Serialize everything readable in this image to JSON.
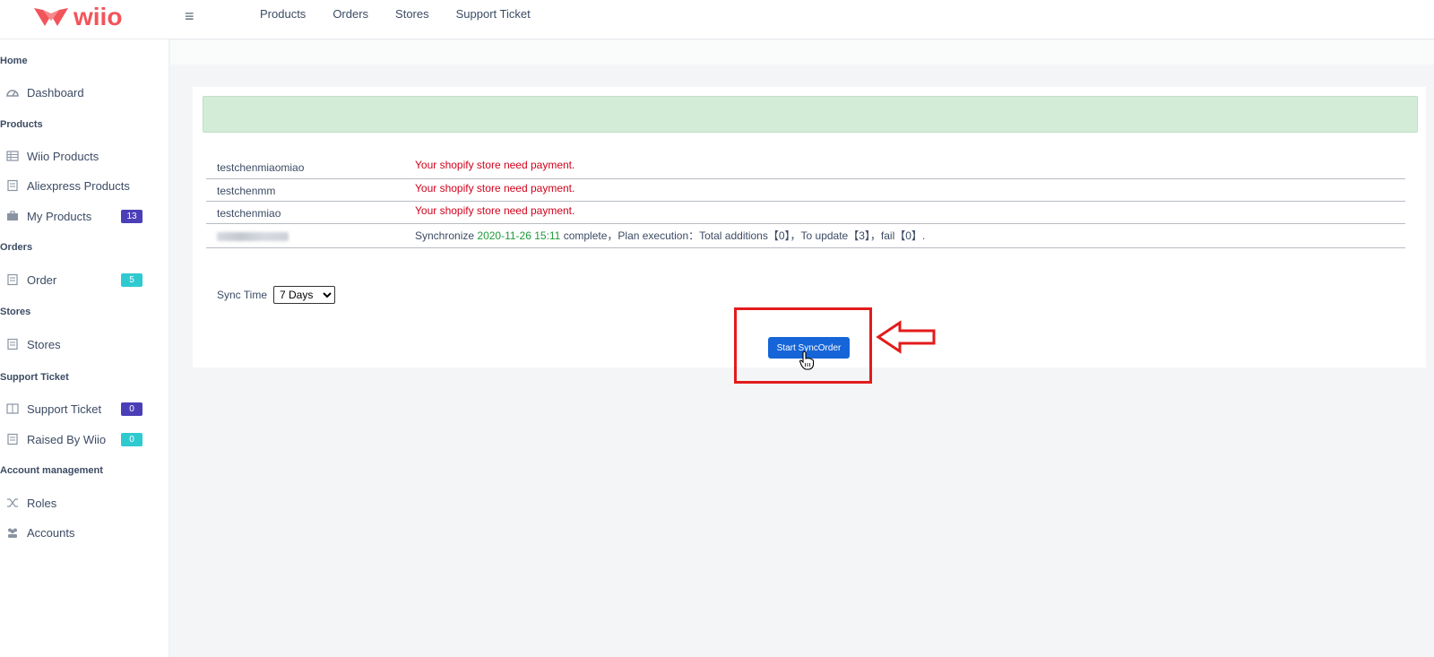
{
  "brand": {
    "name": "wiio"
  },
  "topnav": [
    "Products",
    "Orders",
    "Stores",
    "Support Ticket"
  ],
  "sidebar": {
    "home_section": "Home",
    "dashboard": "Dashboard",
    "products_section": "Products",
    "wiio_products": "Wiio Products",
    "aliexpress_products": "Aliexpress Products",
    "my_products": "My Products",
    "my_products_badge": "13",
    "orders_section": "Orders",
    "order": "Order",
    "order_badge": "5",
    "stores_section": "Stores",
    "stores": "Stores",
    "support_section": "Support Ticket",
    "support_ticket": "Support Ticket",
    "support_ticket_badge": "0",
    "raised_by_wiio": "Raised By Wiio",
    "raised_by_wiio_badge": "0",
    "account_section": "Account management",
    "roles": "Roles",
    "accounts": "Accounts"
  },
  "sync_table": {
    "rows": [
      {
        "store": "testchenmiaomiao",
        "message": "Your shopify store need payment."
      },
      {
        "store": "testchenmm",
        "message": "Your shopify store need payment."
      },
      {
        "store": "testchenmiao",
        "message": "Your shopify store need payment."
      }
    ],
    "last_row": {
      "prefix": "Synchronize",
      "datetime": "2020-11-26 15:11",
      "suffix": "complete，Plan execution：Total additions【0】，To update【3】，fail【0】."
    }
  },
  "sync_time": {
    "label": "Sync Time",
    "selected": "7 Days"
  },
  "start_button": {
    "label": "Start SyncOrder"
  },
  "colors": {
    "brand": "#f2545b",
    "primary": "#1565d8",
    "alert_success": "#d3ecd8",
    "error_text": "#d0021b",
    "highlight": "#e31b1b"
  }
}
